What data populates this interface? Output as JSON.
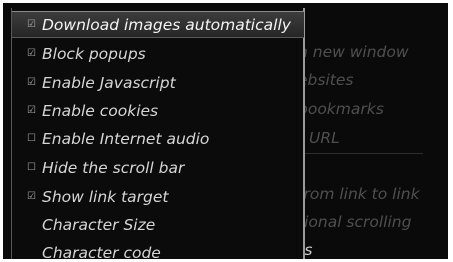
{
  "background_menu": {
    "items": [
      "n new window",
      "ebsites",
      "bookmarks",
      "t URL",
      "",
      "from link to link",
      "tional scrolling",
      "rs"
    ]
  },
  "menu": {
    "items": [
      {
        "label": "Download images automatically",
        "checked": true,
        "selected": true
      },
      {
        "label": "Block popups",
        "checked": true
      },
      {
        "label": "Enable Javascript",
        "checked": true
      },
      {
        "label": "Enable cookies",
        "checked": true
      },
      {
        "label": "Enable Internet audio",
        "checked": false
      },
      {
        "label": "Hide the scroll bar",
        "checked": false
      },
      {
        "label": "Show link target",
        "checked": true
      },
      {
        "label": "Character Size",
        "checked": null
      },
      {
        "label": "Character code",
        "checked": null
      }
    ]
  },
  "glyphs": {
    "checked": "☑",
    "unchecked": "☐"
  }
}
